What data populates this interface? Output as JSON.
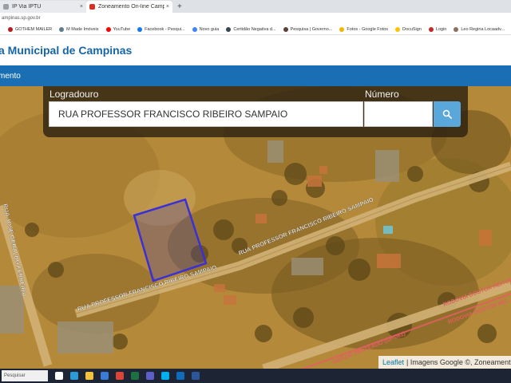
{
  "browser": {
    "tabs": [
      {
        "label": "IP Via IPTU",
        "favicon_color": "#9aa0a6"
      },
      {
        "label": "Zoneamento On-line Campinas",
        "favicon_color": "#d93025"
      }
    ],
    "new_tab_symbol": "+",
    "close_symbol": "×",
    "url": "ampinas.sp.gov.br"
  },
  "bookmarks": [
    {
      "label": "GOTHEM MAILER",
      "color": "#b71c1c"
    },
    {
      "label": "M Made Imóveis",
      "color": "#607d8b"
    },
    {
      "label": "YouTube",
      "color": "#ff0000"
    },
    {
      "label": "Facebook - Pesqui...",
      "color": "#1877f2"
    },
    {
      "label": "Novo guia",
      "color": "#4285f4"
    },
    {
      "label": "Certidão Negativa d...",
      "color": "#37474f"
    },
    {
      "label": "Pesquisa | Governo...",
      "color": "#5d4037"
    },
    {
      "label": "Fotos - Google Fotos",
      "color": "#f4b400"
    },
    {
      "label": "DocuSign",
      "color": "#ffc400"
    },
    {
      "label": "Login",
      "color": "#c62828"
    },
    {
      "label": "Leo Regina Locaadv...",
      "color": "#8d6e63"
    }
  ],
  "page": {
    "title": "a Municipal de Campinas",
    "nav_item": "mento"
  },
  "search": {
    "logradouro_label": "Logradouro",
    "logradouro_value": "RUA PROFESSOR FRANCISCO RIBEIRO SAMPAIO",
    "numero_label": "Número",
    "numero_value": "",
    "button_icon": "search-icon"
  },
  "map": {
    "street_labels": [
      "RUA PROFESSOR FRANCISCO RIBEIRO SAMPAIO",
      "RUA PROFESSOR FRANCISCO RIBEIRO SAMPAIO",
      "RUA JOSÉ GERALDO FERREIRA",
      "RODOVIA DOUTOR HEITOR PENTEADO",
      "RODOVIA DOUTOR HEI...",
      "HEITOR PENTEADO (SP-081)"
    ],
    "parcel_color": "#3b2fd6",
    "attribution_link": "Leaflet",
    "attribution_text": "| Imagens Google ©, Zoneamento"
  },
  "taskbar": {
    "search_placeholder": "Pesquisar",
    "icons": [
      {
        "name": "task-view-icon",
        "color": "#ffffff"
      },
      {
        "name": "edge-icon",
        "color": "#2b9bd8"
      },
      {
        "name": "explorer-icon",
        "color": "#f3c23c"
      },
      {
        "name": "store-icon",
        "color": "#3a7bd5"
      },
      {
        "name": "chrome-icon",
        "color": "#db4437"
      },
      {
        "name": "excel-icon",
        "color": "#1d7044"
      },
      {
        "name": "teams-icon",
        "color": "#5b5fc7"
      },
      {
        "name": "skype-icon",
        "color": "#00aff0"
      },
      {
        "name": "outlook-icon",
        "color": "#0f6cbd"
      },
      {
        "name": "word-icon",
        "color": "#2b579a"
      }
    ]
  }
}
